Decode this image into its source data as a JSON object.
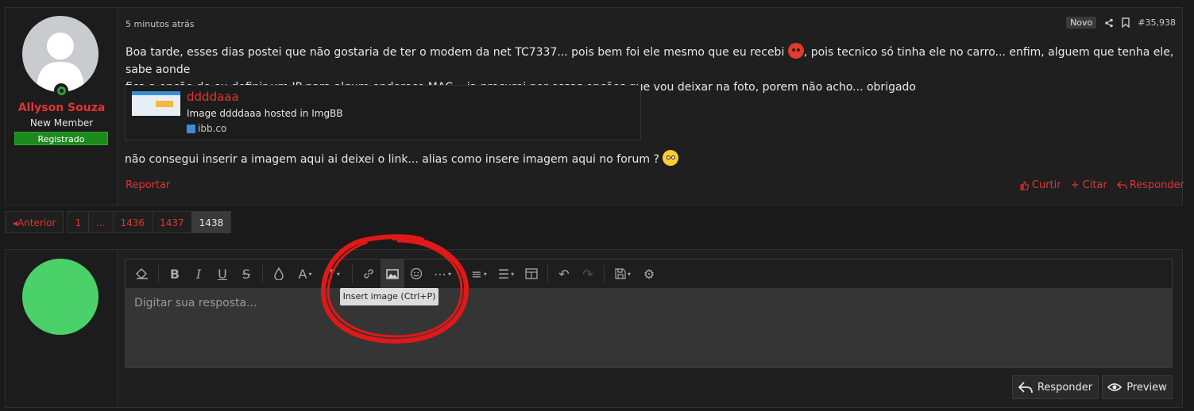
{
  "post": {
    "time": "5 minutos atrás",
    "badge": "Novo",
    "number": "#35,938",
    "user": {
      "name": "Allyson Souza",
      "title": "New Member",
      "banner": "Registrado"
    },
    "body_p1": "Boa tarde, esses dias postei que não gostaria de ter o modem da net TC7337... pois bem foi ele mesmo que eu recebi",
    "body_p2": ", pois tecnico só tinha ele no carro... enfim, alguem que tenha ele, sabe aonde",
    "body_p3": "fica a opção de eu definir um IP para algum endereço MAC... ja procurei por essas opções que vou deixar na foto, porem não acho... obrigado",
    "link": {
      "title": "ddddaaa",
      "desc": "Image ddddaaa hosted in ImgBB",
      "domain": "ibb.co"
    },
    "body_p4": "não consegui inserir a imagem aqui ai deixei o link... alias como insere imagem aqui no forum ?",
    "report": "Reportar",
    "actions": {
      "like": "Curtir",
      "quote": "+ Citar",
      "reply": "Responder"
    }
  },
  "pagination": {
    "prev": "Anterior",
    "pages": [
      "1",
      "...",
      "1436",
      "1437",
      "1438"
    ],
    "current": "1438"
  },
  "editor": {
    "placeholder": "Digitar sua resposta...",
    "tooltip": "Insert image (Ctrl+P)",
    "reply_button": "Responder",
    "preview_button": "Preview"
  },
  "colors": {
    "accent": "#e03434",
    "banner": "#1d8a1d",
    "avatar": "#4bd16a"
  }
}
